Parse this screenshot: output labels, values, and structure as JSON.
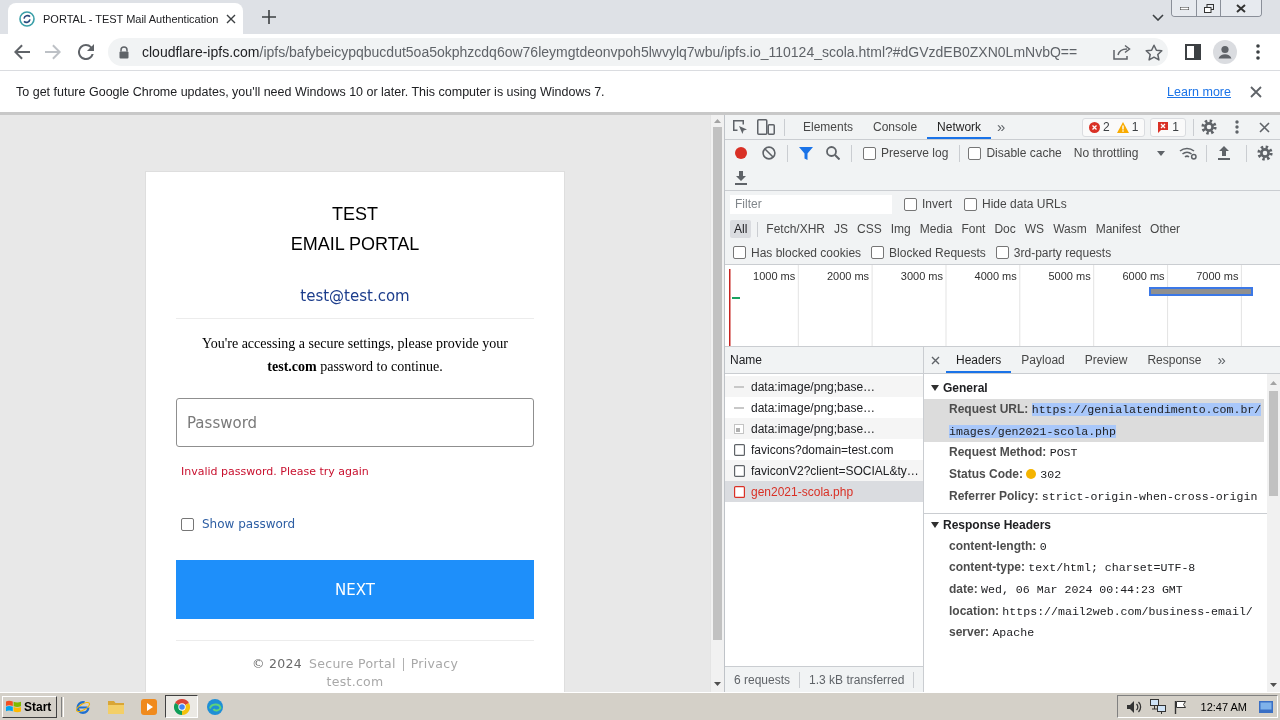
{
  "browser": {
    "tabs": [
      {
        "title": "PORTAL - TEST Mail Authentication",
        "selected": true
      }
    ],
    "toolbar": {
      "forward_disabled": true,
      "url": {
        "host": "cloudflare-ipfs.com",
        "path": "/ipfs/bafybeicypqbucdut5oa5okphzcdq6ow76leymgtdeonvpoh5lwvylq7wbu/ipfs.io_110124_scola.html?#dGVzdEB0ZXN0LmNvbQ=="
      }
    },
    "infobar": {
      "message": "To get future Google Chrome updates, you'll need Windows 10 or later. This computer is using Windows 7.",
      "link": "Learn more"
    }
  },
  "page": {
    "title_lines": [
      "TEST",
      "EMAIL PORTAL"
    ],
    "email": "test@test.com",
    "prompt": "You're accessing a secure settings, please provide your **test.com** password to continue.",
    "password": {
      "placeholder": "Password"
    },
    "error": "Invalid password. Please try again",
    "show_password": {
      "label": "Show password",
      "checked": false
    },
    "submit": "NEXT",
    "footer": {
      "copyright": "© 2024",
      "links": [
        "Secure Portal",
        "Privacy"
      ],
      "domain": "test.com"
    }
  },
  "devtools": {
    "tabs": [
      {
        "label": "Elements",
        "selected": false
      },
      {
        "label": "Console",
        "selected": false
      },
      {
        "label": "Network",
        "selected": true
      }
    ],
    "more": "»",
    "counts": {
      "errors": "2",
      "warnings": "1",
      "issues": "1"
    },
    "toolbar": {
      "recording": true,
      "options": [
        {
          "label": "Preserve log",
          "checked": false
        },
        {
          "label": "Disable cache",
          "checked": false
        }
      ],
      "throttling": "No throttling"
    },
    "filter": {
      "placeholder": "Filter",
      "options": [
        {
          "label": "Invert",
          "checked": false
        },
        {
          "label": "Hide data URLs",
          "checked": false
        }
      ]
    },
    "types": [
      {
        "label": "All",
        "selected": true
      },
      {
        "label": "Fetch/XHR",
        "selected": false
      },
      {
        "label": "JS",
        "selected": false
      },
      {
        "label": "CSS",
        "selected": false
      },
      {
        "label": "Img",
        "selected": false
      },
      {
        "label": "Media",
        "selected": false
      },
      {
        "label": "Font",
        "selected": false
      },
      {
        "label": "Doc",
        "selected": false
      },
      {
        "label": "WS",
        "selected": false
      },
      {
        "label": "Wasm",
        "selected": false
      },
      {
        "label": "Manifest",
        "selected": false
      },
      {
        "label": "Other",
        "selected": false
      }
    ],
    "request_filters": [
      {
        "label": "Has blocked cookies",
        "checked": false
      },
      {
        "label": "Blocked Requests",
        "checked": false
      },
      {
        "label": "3rd-party requests",
        "checked": false
      }
    ],
    "overview": {
      "ticks": [
        "1000 ms",
        "2000 ms",
        "3000 ms",
        "4000 ms",
        "5000 ms",
        "6000 ms",
        "7000 ms"
      ]
    },
    "requests": {
      "column": "Name",
      "rows": [
        {
          "name": "data:image/png;base…",
          "kind": "line",
          "failed": false,
          "selected": false
        },
        {
          "name": "data:image/png;base…",
          "kind": "line",
          "failed": false,
          "selected": false
        },
        {
          "name": "data:image/png;base…",
          "kind": "image",
          "failed": false,
          "selected": false
        },
        {
          "name": "favicons?domain=test.com",
          "kind": "document",
          "failed": false,
          "selected": false
        },
        {
          "name": "faviconV2?client=SOCIAL&ty…",
          "kind": "document",
          "failed": false,
          "selected": false
        },
        {
          "name": "gen2021-scola.php",
          "kind": "document",
          "failed": true,
          "selected": true
        }
      ]
    },
    "summary": [
      "6 requests",
      "1.3 kB transferred"
    ],
    "details": {
      "tabs": [
        {
          "label": "Headers",
          "selected": true
        },
        {
          "label": "Payload",
          "selected": false
        },
        {
          "label": "Preview",
          "selected": false
        },
        {
          "label": "Response",
          "selected": false
        }
      ],
      "more": "»",
      "sections": [
        {
          "title": "General",
          "expanded": true,
          "fields": [
            {
              "label": "Request URL:",
              "value": "https://genialatendimento.com.br/images/gen2021-scola.php",
              "highlighted": true
            },
            {
              "label": "Request Method:",
              "value": "POST",
              "highlighted": false
            },
            {
              "label": "Status Code:",
              "value": "302",
              "color": "#f5b400",
              "highlighted": false
            },
            {
              "label": "Referrer Policy:",
              "value": "strict-origin-when-cross-origin",
              "highlighted": false
            }
          ]
        },
        {
          "title": "Response Headers",
          "expanded": true,
          "fields": [
            {
              "label": "content-length:",
              "value": "0",
              "highlighted": false
            },
            {
              "label": "content-type:",
              "value": "text/html; charset=UTF-8",
              "highlighted": false
            },
            {
              "label": "date:",
              "value": "Wed, 06 Mar 2024 00:44:23 GMT",
              "highlighted": false
            },
            {
              "label": "location:",
              "value": "https://mail2web.com/business-email/",
              "highlighted": false
            },
            {
              "label": "server:",
              "value": "Apache",
              "highlighted": false
            }
          ]
        }
      ]
    }
  },
  "taskbar": {
    "start": "Start",
    "apps": [
      {
        "kind": "e-globe",
        "active": false
      },
      {
        "kind": "folder",
        "active": false
      },
      {
        "kind": "player",
        "active": false
      },
      {
        "kind": "circle-logo",
        "active": true
      },
      {
        "kind": "wave-logo",
        "active": false
      }
    ],
    "clock": "12:47 AM"
  }
}
